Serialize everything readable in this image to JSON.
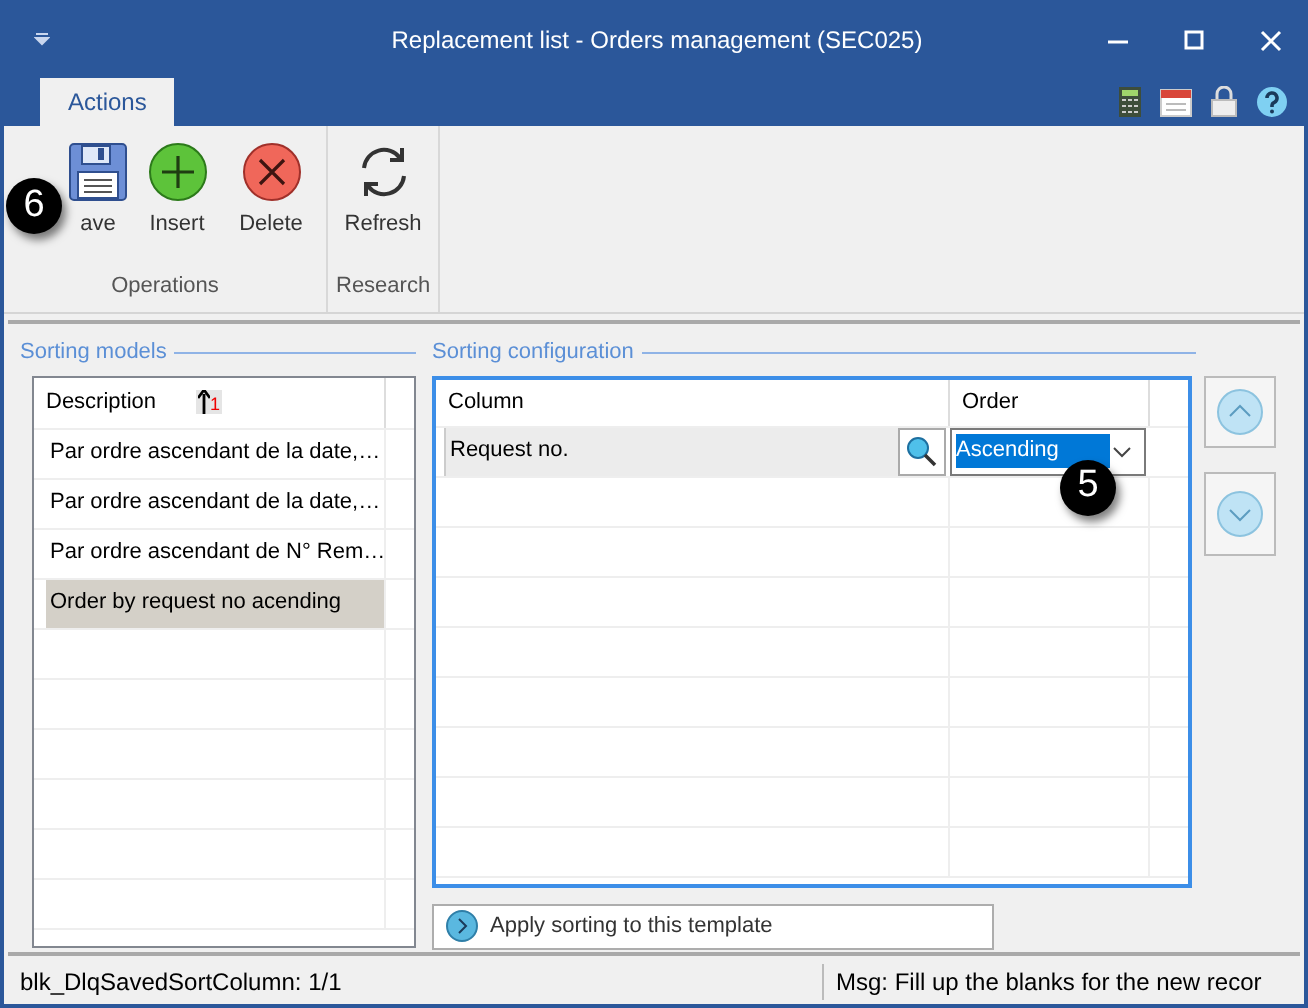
{
  "window": {
    "title": "Replacement list - Orders management (SEC025)"
  },
  "tabs": [
    {
      "label": "Actions",
      "selected": true
    }
  ],
  "ribbon": {
    "groups": [
      {
        "label": "Operations",
        "buttons": [
          {
            "kind": "save",
            "label": "ave"
          },
          {
            "kind": "insert",
            "label": "Insert"
          },
          {
            "kind": "delete",
            "label": "Delete"
          }
        ]
      },
      {
        "label": "Research",
        "buttons": [
          {
            "kind": "refresh",
            "label": "Refresh"
          }
        ]
      }
    ]
  },
  "callouts": [
    {
      "kind": "ribbon",
      "text": "6"
    },
    {
      "kind": "order",
      "text": "5"
    }
  ],
  "sorting_models": {
    "title": "Sorting models",
    "column": "Description",
    "sort_badge": "1",
    "rows": [
      {
        "text": "Par ordre ascendant de la date,…",
        "selected": false
      },
      {
        "text": "Par ordre ascendant de la date,…",
        "selected": false
      },
      {
        "text": "Par ordre ascendant de N° Rem…",
        "selected": false
      },
      {
        "text": "Order by request no acending",
        "selected": true
      }
    ]
  },
  "sorting_configuration": {
    "title": "Sorting configuration",
    "columns": [
      "Column",
      "Order"
    ],
    "rows": [
      {
        "column": "Request no.",
        "order": "Ascending"
      }
    ],
    "apply_button": "Apply sorting to this template"
  },
  "status_bar": {
    "left": "blk_DlqSavedSortColumn: 1/1",
    "right": "Msg: Fill up the blanks for the new recor"
  }
}
